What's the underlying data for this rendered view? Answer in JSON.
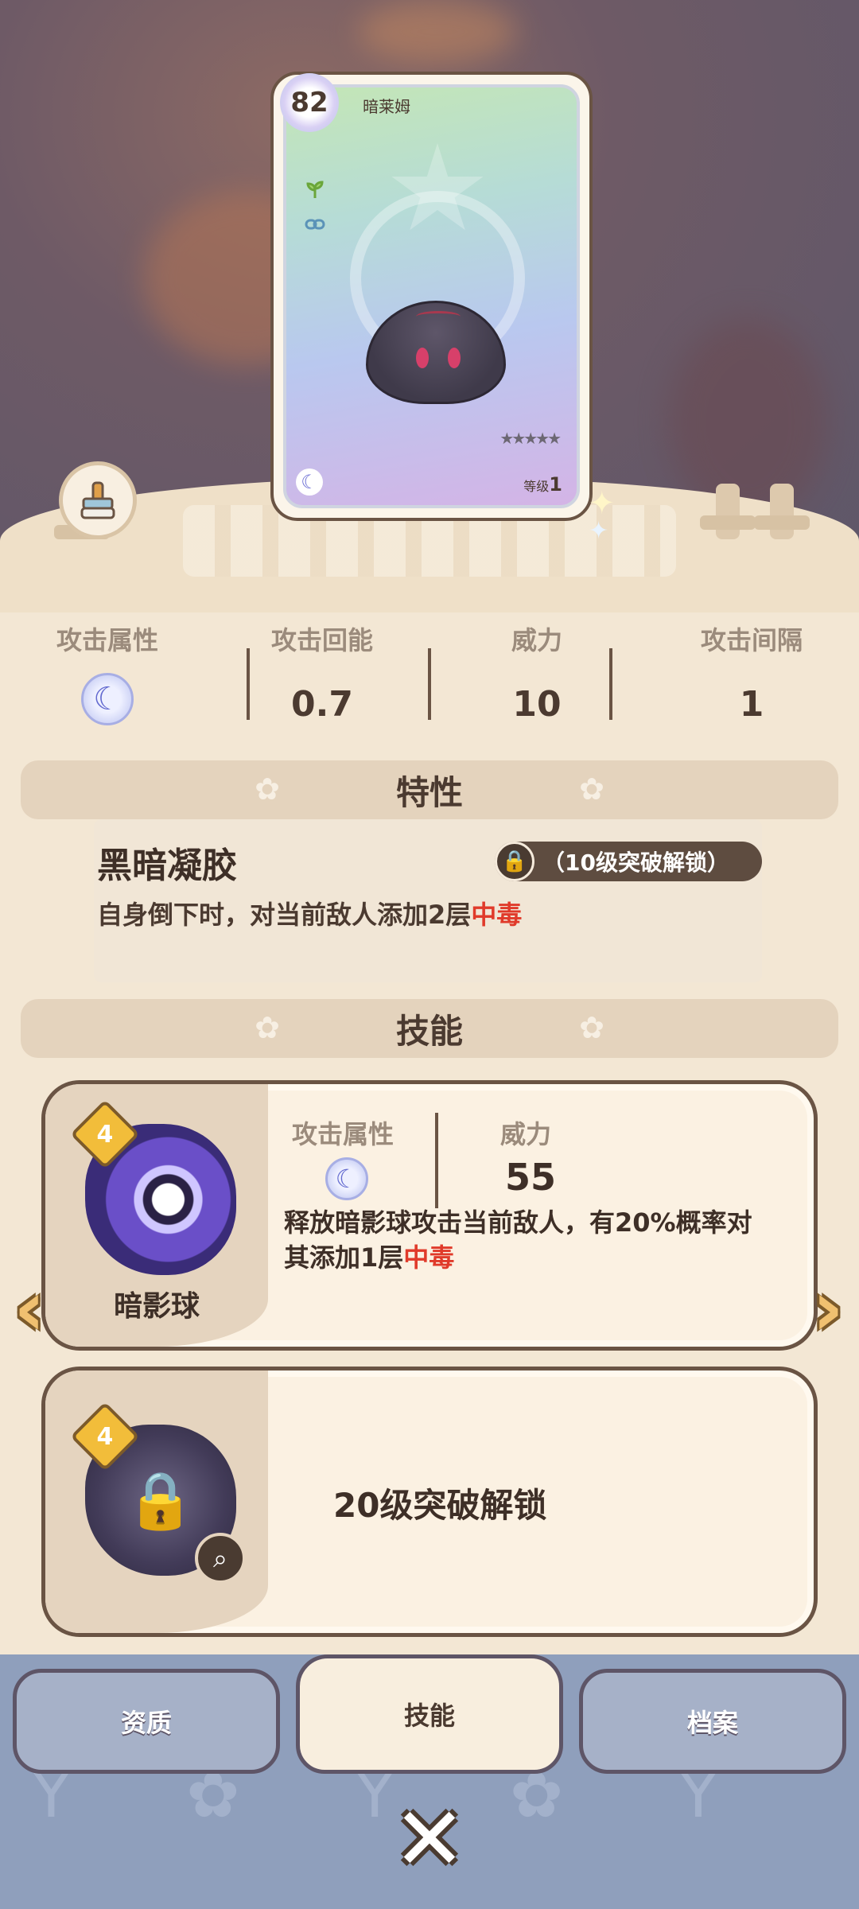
{
  "card": {
    "level": "82",
    "name": "暗莱姆",
    "level_label": "等级",
    "level_value": "1",
    "type_icon": "sprout-icon",
    "link_icon": "link-icon",
    "element_icon": "moon-icon"
  },
  "stats": {
    "items": [
      {
        "label": "攻击属性",
        "value": ""
      },
      {
        "label": "攻击回能",
        "value": "0.7"
      },
      {
        "label": "威力",
        "value": "10"
      },
      {
        "label": "攻击间隔",
        "value": "1"
      }
    ]
  },
  "traits": {
    "header": "特性",
    "title": "黑暗凝胶",
    "lock_label": "（10级突破解锁）",
    "desc_prefix": "自身倒下时，对当前敌人添加2层",
    "desc_highlight": "中毒"
  },
  "skills": {
    "header": "技能",
    "skill1": {
      "tier": "4",
      "name": "暗影球",
      "attr_label": "攻击属性",
      "power_label": "威力",
      "power_value": "55",
      "desc_line1": "释放暗影球攻击当前敌人，有20%概率对",
      "desc_line2_prefix": "其添加1层",
      "desc_highlight": "中毒"
    },
    "skill2": {
      "tier": "4",
      "locked_text": "20级突破解锁"
    }
  },
  "tabs": [
    {
      "label": "资质"
    },
    {
      "label": "技能"
    },
    {
      "label": "档案"
    }
  ],
  "colors": {
    "accent": "#e03a2a",
    "text_dark": "#3e2f27",
    "panel": "#e4d3bd",
    "nav_bg": "#8f9fbc"
  }
}
